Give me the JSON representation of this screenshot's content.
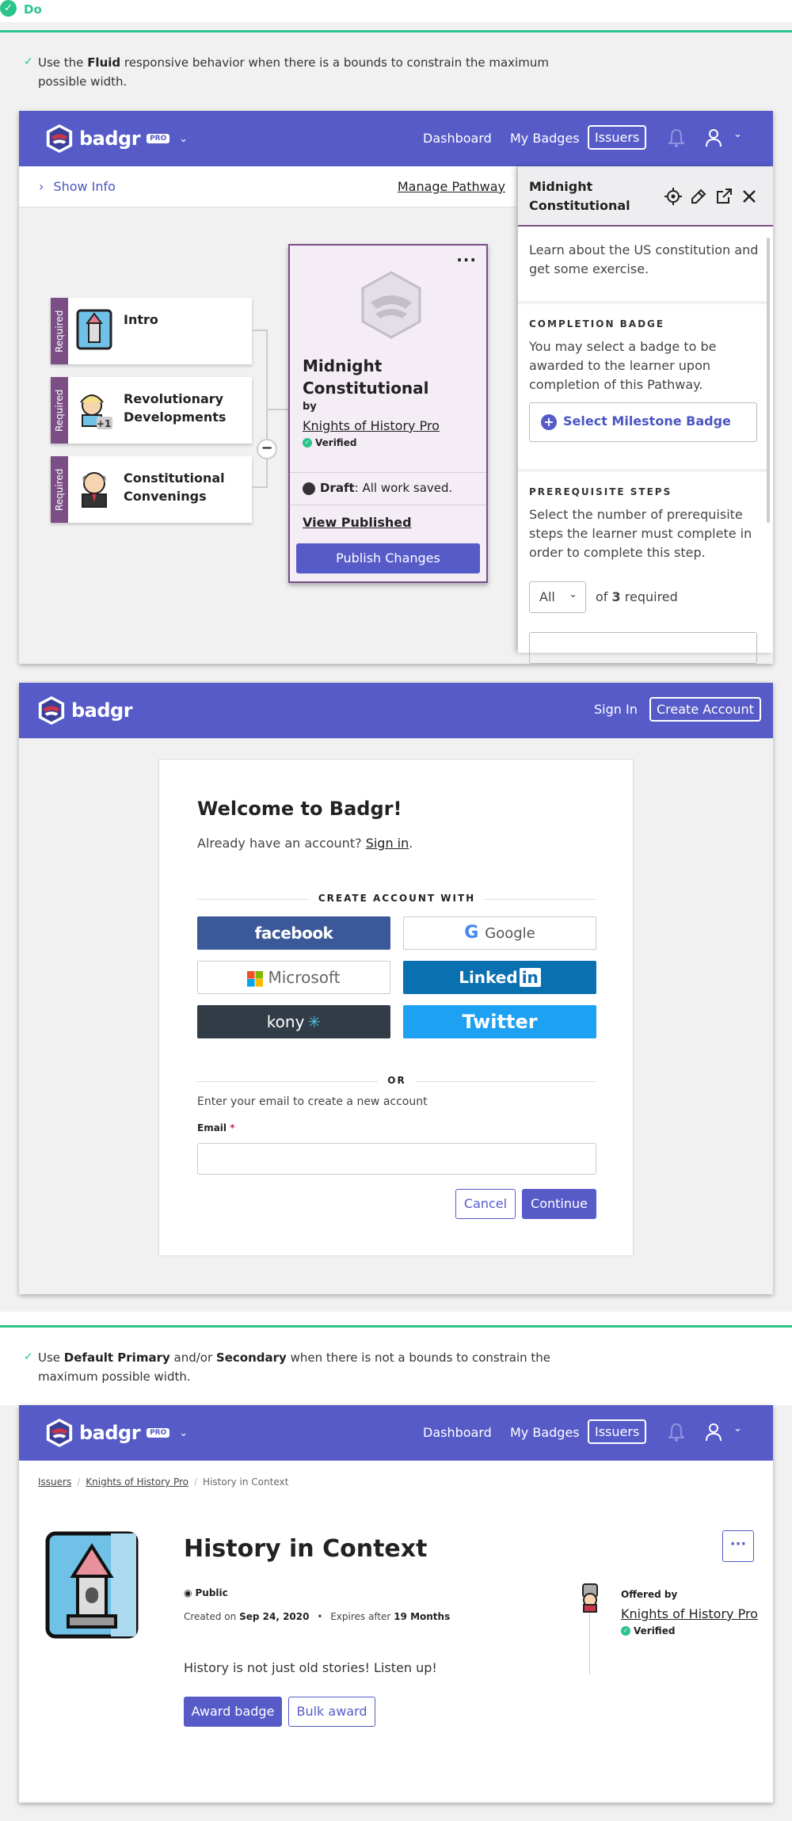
{
  "header": {
    "do_label": "Do"
  },
  "guideline1": {
    "before": "Use the ",
    "bold": "Fluid",
    "after": " responsive behavior when there is a bounds to constrain the maximum possible width."
  },
  "guideline2": {
    "before": "Use ",
    "bold1": "Default Primary",
    "mid": " and/or ",
    "bold2": "Secondary",
    "after": " when there is not a bounds to constrain the maximum possible width."
  },
  "nav": {
    "logo": "badgr",
    "pro": "PRO",
    "dashboard": "Dashboard",
    "my_badges": "My Badges",
    "issuers": "Issuers",
    "sign_in": "Sign In",
    "create_account": "Create Account"
  },
  "pathway": {
    "show_info": "Show Info",
    "manage_pathway": "Manage Pathway",
    "required_label": "Required",
    "steps": [
      {
        "title": "Intro",
        "icon": "tower-badge-icon"
      },
      {
        "title": "Revolutionary Developments",
        "icon": "founder-avatar-icon",
        "extra": "+1"
      },
      {
        "title": "Constitutional Convenings",
        "icon": "bald-man-avatar-icon"
      }
    ],
    "card": {
      "title": "Midnight Constitutional",
      "by": "by",
      "issuer": "Knights of History Pro",
      "verified": "Verified",
      "draft_bold": "Draft",
      "draft_rest": ": All work saved.",
      "view_published": "View Published",
      "publish": "Publish Changes"
    },
    "panel": {
      "title": "Midnight Constitutional",
      "description": "Learn about the US constitution and get some exercise.",
      "completion_label": "COMPLETION BADGE",
      "completion_text": "You may select a badge to be awarded to the learner upon completion of this Pathway.",
      "select_milestone": "Select Milestone Badge",
      "prereq_label": "PREREQUISITE STEPS",
      "prereq_text": "Select the number of prerequisite steps the learner must complete in order to complete this step.",
      "all_option": "All",
      "of": "of",
      "count": "3",
      "required": "required"
    }
  },
  "signup": {
    "welcome": "Welcome to Badgr!",
    "already": "Already have an account?",
    "sign_in_link": "Sign in",
    "create_with": "CREATE ACCOUNT WITH",
    "providers": {
      "facebook": "facebook",
      "google": "Google",
      "microsoft": "Microsoft",
      "linkedin": "Linked",
      "linkedin_in": "in",
      "kony": "kony",
      "twitter": "Twitter"
    },
    "or": "OR",
    "enter_email": "Enter your email to create a new account",
    "email_label": "Email",
    "required_mark": "*",
    "email_value": "",
    "cancel": "Cancel",
    "continue": "Continue"
  },
  "badge_detail": {
    "breadcrumbs": [
      "Issuers",
      "Knights of History Pro",
      "History in Context"
    ],
    "title": "History in Context",
    "more": "···",
    "public": "Public",
    "created_prefix": "Created on",
    "created_date": "Sep 24, 2020",
    "expires_prefix": "Expires after",
    "expires_value": "19 Months",
    "bullet": "•",
    "description": "History is not just old stories! Listen up!",
    "award": "Award badge",
    "bulk": "Bulk award",
    "offered_by": "Offered by",
    "issuer": "Knights of History Pro",
    "verified": "Verified"
  },
  "colors": {
    "brand": "#565bc8",
    "accent_green": "#2bc48a",
    "pathway_purple": "#7b4e86"
  }
}
